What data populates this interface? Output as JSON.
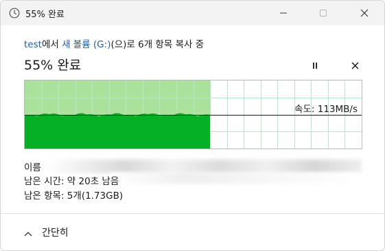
{
  "window": {
    "title": "55% 완료",
    "icons": {
      "app": "clock-icon",
      "minimize": "minimize-icon",
      "maximize": "maximize-icon",
      "close": "close-icon"
    }
  },
  "copy": {
    "source": "test",
    "from_suffix": "에서 ",
    "destination": "새 볼륨 (G:)",
    "to_suffix": "(으)로 6개 항목 복사 중",
    "progress_title": "55% 완료",
    "progress_percent": 55,
    "speed_label": "속도: 113MB/s",
    "icons": {
      "pause": "pause-icon",
      "cancel": "cancel-icon"
    }
  },
  "details": {
    "name_label": "이름",
    "name_value": "",
    "time_left": "남은 시간: 약 20초 남음",
    "items_left": "남은 항목: 5개(1.73GB)"
  },
  "footer": {
    "collapse_label": "간단히",
    "icon": "chevron-up-icon"
  },
  "colors": {
    "progress_fill_light": "#a8e29b",
    "progress_fill_dark": "#06b025",
    "grid": "#b8e6c8",
    "link": "#1d5fa8"
  }
}
